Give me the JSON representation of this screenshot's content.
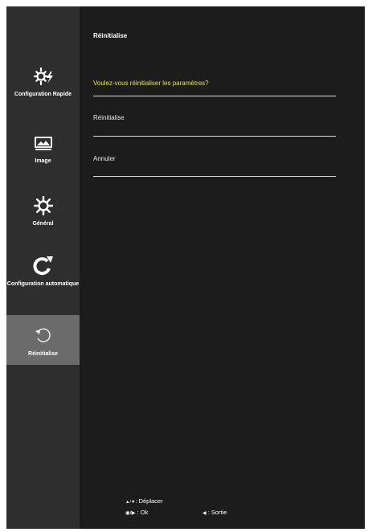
{
  "sidebar": {
    "items": [
      {
        "label": "Configuration Rapide",
        "icon": "gear-lightning-icon"
      },
      {
        "label": "Image",
        "icon": "monitor-image-icon"
      },
      {
        "label": "Général",
        "icon": "gear-icon"
      },
      {
        "label": "Configuration automatique",
        "icon": "auto-config-icon"
      },
      {
        "label": "Réinitialise",
        "icon": "reset-arrow-icon",
        "active": true
      }
    ]
  },
  "main": {
    "title": "Réinitialise",
    "question": "Voulez-vous réinitialiser les paramètres?",
    "options": [
      "Réinitialise",
      "Annuler"
    ]
  },
  "footer": {
    "move_keys": "▲/▼",
    "move_label": ": Déplacer",
    "ok_keys": "◉/▶",
    "ok_label": " : Ok",
    "exit_keys": "◀",
    "exit_label": " : Sortie"
  },
  "colors": {
    "background": "#1c1c1c",
    "sidebar": "#2e2e2e",
    "active_item": "#6b6b6b",
    "question_text": "#e6e05a"
  }
}
